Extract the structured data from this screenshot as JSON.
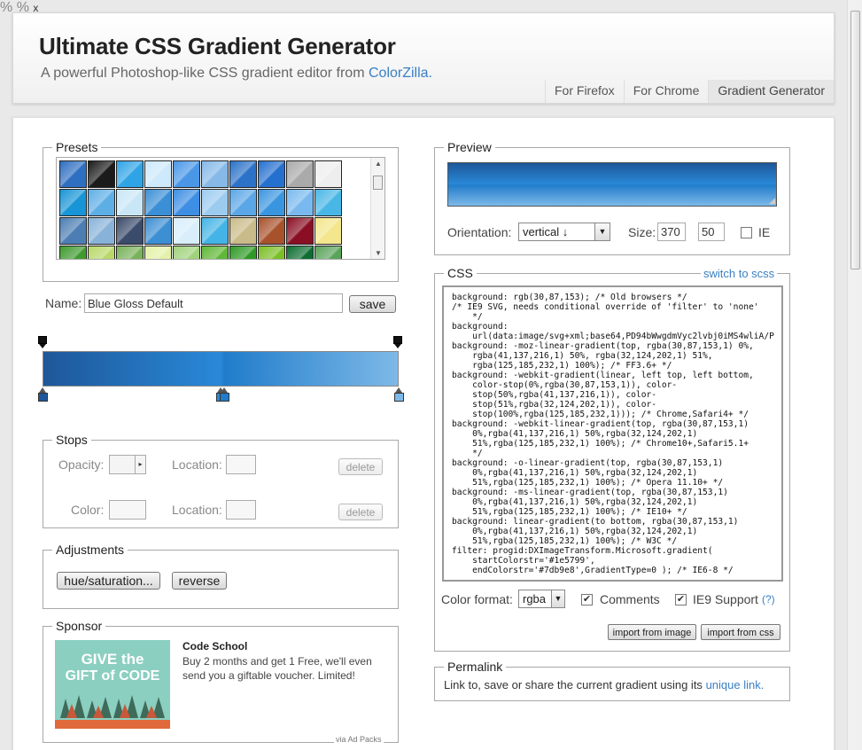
{
  "header": {
    "title": "Ultimate CSS Gradient Generator",
    "subtitle": "A powerful Photoshop-like CSS gradient editor from",
    "subtitle_link": "ColorZilla.",
    "nav": [
      "For Firefox",
      "For Chrome",
      "Gradient Generator"
    ]
  },
  "presets": {
    "legend": "Presets",
    "swatches": [
      "#2f6fc2",
      "#1b1b1b",
      "#2ea4e6",
      "#cde9fb",
      "#4a97e8",
      "#86b9e8",
      "#2b72c8",
      "#2570cf",
      "#aaaaaa",
      "#eeeeee",
      "#1895d6",
      "#5eaee6",
      "#c9e6f6",
      "#3b8fd6",
      "#3e8ee4",
      "#9ccbf0",
      "#5aa6e6",
      "#3a95e0",
      "#7ab9ef",
      "#49b7e6",
      "#4c7eb3",
      "#89b2d9",
      "#3a4b6b",
      "#3d8fd4",
      "#d8eefb",
      "#44b4e6",
      "#c9bb8a",
      "#a8522c",
      "#8a0f24",
      "#f3e68c",
      "#3f9b2f",
      "#b9d86a",
      "#79b25a",
      "#e3f2a8",
      "#a0d27c",
      "#5fb836",
      "#2f9a26",
      "#7bbf26",
      "#0e6e32",
      "#5aa35a"
    ]
  },
  "name": {
    "label": "Name:",
    "value": "Blue Gloss Default",
    "save": "save"
  },
  "gradient": {
    "stops": [
      {
        "color": "#1e5799",
        "location": 0
      },
      {
        "color": "#2989d8",
        "location": 50
      },
      {
        "color": "#207cca",
        "location": 51
      },
      {
        "color": "#7db9e8",
        "location": 100
      }
    ]
  },
  "stops_panel": {
    "legend": "Stops",
    "opacity_label": "Opacity:",
    "location_label": "Location:",
    "color_label": "Color:",
    "percent": "%",
    "delete": "delete"
  },
  "adjustments": {
    "legend": "Adjustments",
    "hue": "hue/saturation...",
    "reverse": "reverse"
  },
  "sponsor": {
    "legend": "Sponsor",
    "title": "Code School",
    "text": "Buy 2 months and get 1 Free, we'll even send you a giftable voucher. Limited!",
    "img_line1": "GIVE the",
    "img_line2": "GIFT of CODE",
    "via": "via Ad Packs"
  },
  "preview": {
    "legend": "Preview",
    "orientation_label": "Orientation:",
    "orientation_value": "vertical ↓",
    "size_label": "Size:",
    "width": "370",
    "x": "x",
    "height": "50",
    "ie_label": "IE"
  },
  "css": {
    "legend": "CSS",
    "switch": "switch to scss",
    "code": "background: rgb(30,87,153); /* Old browsers */\n/* IE9 SVG, needs conditional override of 'filter' to 'none'\n    */\nbackground:\n    url(data:image/svg+xml;base64,PD94bWwgdmVyc2lvbj0iMS4wliA/P\nbackground: -moz-linear-gradient(top, rgba(30,87,153,1) 0%,\n    rgba(41,137,216,1) 50%, rgba(32,124,202,1) 51%,\n    rgba(125,185,232,1) 100%); /* FF3.6+ */\nbackground: -webkit-gradient(linear, left top, left bottom,\n    color-stop(0%,rgba(30,87,153,1)), color-\n    stop(50%,rgba(41,137,216,1)), color-\n    stop(51%,rgba(32,124,202,1)), color-\n    stop(100%,rgba(125,185,232,1))); /* Chrome,Safari4+ */\nbackground: -webkit-linear-gradient(top, rgba(30,87,153,1)\n    0%,rgba(41,137,216,1) 50%,rgba(32,124,202,1)\n    51%,rgba(125,185,232,1) 100%); /* Chrome10+,Safari5.1+\n    */\nbackground: -o-linear-gradient(top, rgba(30,87,153,1)\n    0%,rgba(41,137,216,1) 50%,rgba(32,124,202,1)\n    51%,rgba(125,185,232,1) 100%); /* Opera 11.10+ */\nbackground: -ms-linear-gradient(top, rgba(30,87,153,1)\n    0%,rgba(41,137,216,1) 50%,rgba(32,124,202,1)\n    51%,rgba(125,185,232,1) 100%); /* IE10+ */\nbackground: linear-gradient(to bottom, rgba(30,87,153,1)\n    0%,rgba(41,137,216,1) 50%,rgba(32,124,202,1)\n    51%,rgba(125,185,232,1) 100%); /* W3C */\nfilter: progid:DXImageTransform.Microsoft.gradient(\n    startColorstr='#1e5799',\n    endColorstr='#7db9e8',GradientType=0 ); /* IE6-8 */",
    "format_label": "Color format:",
    "format_value": "rgba",
    "comments_label": "Comments",
    "ie9_label": "IE9 Support",
    "ie9_help": "(?)",
    "import_image": "import from image",
    "import_css": "import from css"
  },
  "permalink": {
    "legend": "Permalink",
    "text": "Link to, save or share the current gradient using its",
    "link": "unique link."
  }
}
